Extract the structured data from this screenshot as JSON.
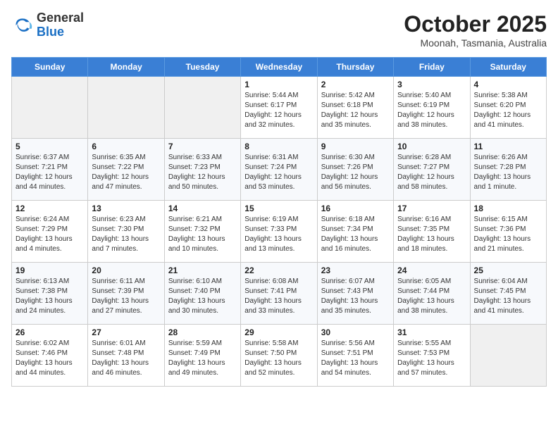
{
  "header": {
    "logo_general": "General",
    "logo_blue": "Blue",
    "month": "October 2025",
    "location": "Moonah, Tasmania, Australia"
  },
  "days_of_week": [
    "Sunday",
    "Monday",
    "Tuesday",
    "Wednesday",
    "Thursday",
    "Friday",
    "Saturday"
  ],
  "weeks": [
    [
      {
        "day": "",
        "content": ""
      },
      {
        "day": "",
        "content": ""
      },
      {
        "day": "",
        "content": ""
      },
      {
        "day": "1",
        "content": "Sunrise: 5:44 AM\nSunset: 6:17 PM\nDaylight: 12 hours and 32 minutes."
      },
      {
        "day": "2",
        "content": "Sunrise: 5:42 AM\nSunset: 6:18 PM\nDaylight: 12 hours and 35 minutes."
      },
      {
        "day": "3",
        "content": "Sunrise: 5:40 AM\nSunset: 6:19 PM\nDaylight: 12 hours and 38 minutes."
      },
      {
        "day": "4",
        "content": "Sunrise: 5:38 AM\nSunset: 6:20 PM\nDaylight: 12 hours and 41 minutes."
      }
    ],
    [
      {
        "day": "5",
        "content": "Sunrise: 6:37 AM\nSunset: 7:21 PM\nDaylight: 12 hours and 44 minutes."
      },
      {
        "day": "6",
        "content": "Sunrise: 6:35 AM\nSunset: 7:22 PM\nDaylight: 12 hours and 47 minutes."
      },
      {
        "day": "7",
        "content": "Sunrise: 6:33 AM\nSunset: 7:23 PM\nDaylight: 12 hours and 50 minutes."
      },
      {
        "day": "8",
        "content": "Sunrise: 6:31 AM\nSunset: 7:24 PM\nDaylight: 12 hours and 53 minutes."
      },
      {
        "day": "9",
        "content": "Sunrise: 6:30 AM\nSunset: 7:26 PM\nDaylight: 12 hours and 56 minutes."
      },
      {
        "day": "10",
        "content": "Sunrise: 6:28 AM\nSunset: 7:27 PM\nDaylight: 12 hours and 58 minutes."
      },
      {
        "day": "11",
        "content": "Sunrise: 6:26 AM\nSunset: 7:28 PM\nDaylight: 13 hours and 1 minute."
      }
    ],
    [
      {
        "day": "12",
        "content": "Sunrise: 6:24 AM\nSunset: 7:29 PM\nDaylight: 13 hours and 4 minutes."
      },
      {
        "day": "13",
        "content": "Sunrise: 6:23 AM\nSunset: 7:30 PM\nDaylight: 13 hours and 7 minutes."
      },
      {
        "day": "14",
        "content": "Sunrise: 6:21 AM\nSunset: 7:32 PM\nDaylight: 13 hours and 10 minutes."
      },
      {
        "day": "15",
        "content": "Sunrise: 6:19 AM\nSunset: 7:33 PM\nDaylight: 13 hours and 13 minutes."
      },
      {
        "day": "16",
        "content": "Sunrise: 6:18 AM\nSunset: 7:34 PM\nDaylight: 13 hours and 16 minutes."
      },
      {
        "day": "17",
        "content": "Sunrise: 6:16 AM\nSunset: 7:35 PM\nDaylight: 13 hours and 18 minutes."
      },
      {
        "day": "18",
        "content": "Sunrise: 6:15 AM\nSunset: 7:36 PM\nDaylight: 13 hours and 21 minutes."
      }
    ],
    [
      {
        "day": "19",
        "content": "Sunrise: 6:13 AM\nSunset: 7:38 PM\nDaylight: 13 hours and 24 minutes."
      },
      {
        "day": "20",
        "content": "Sunrise: 6:11 AM\nSunset: 7:39 PM\nDaylight: 13 hours and 27 minutes."
      },
      {
        "day": "21",
        "content": "Sunrise: 6:10 AM\nSunset: 7:40 PM\nDaylight: 13 hours and 30 minutes."
      },
      {
        "day": "22",
        "content": "Sunrise: 6:08 AM\nSunset: 7:41 PM\nDaylight: 13 hours and 33 minutes."
      },
      {
        "day": "23",
        "content": "Sunrise: 6:07 AM\nSunset: 7:43 PM\nDaylight: 13 hours and 35 minutes."
      },
      {
        "day": "24",
        "content": "Sunrise: 6:05 AM\nSunset: 7:44 PM\nDaylight: 13 hours and 38 minutes."
      },
      {
        "day": "25",
        "content": "Sunrise: 6:04 AM\nSunset: 7:45 PM\nDaylight: 13 hours and 41 minutes."
      }
    ],
    [
      {
        "day": "26",
        "content": "Sunrise: 6:02 AM\nSunset: 7:46 PM\nDaylight: 13 hours and 44 minutes."
      },
      {
        "day": "27",
        "content": "Sunrise: 6:01 AM\nSunset: 7:48 PM\nDaylight: 13 hours and 46 minutes."
      },
      {
        "day": "28",
        "content": "Sunrise: 5:59 AM\nSunset: 7:49 PM\nDaylight: 13 hours and 49 minutes."
      },
      {
        "day": "29",
        "content": "Sunrise: 5:58 AM\nSunset: 7:50 PM\nDaylight: 13 hours and 52 minutes."
      },
      {
        "day": "30",
        "content": "Sunrise: 5:56 AM\nSunset: 7:51 PM\nDaylight: 13 hours and 54 minutes."
      },
      {
        "day": "31",
        "content": "Sunrise: 5:55 AM\nSunset: 7:53 PM\nDaylight: 13 hours and 57 minutes."
      },
      {
        "day": "",
        "content": ""
      }
    ]
  ]
}
